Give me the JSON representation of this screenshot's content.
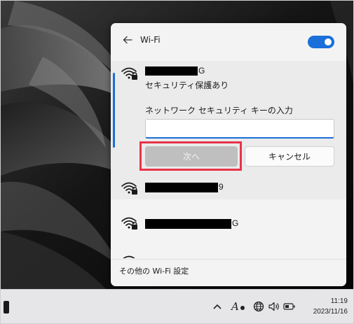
{
  "panel": {
    "title": "Wi-Fi",
    "toggle_on": true,
    "accent_color": "#1a6fd9"
  },
  "connecting_network": {
    "ssid_visible_suffix": "G",
    "security_status": "セキュリティ保護あり",
    "key_label": "ネットワーク セキュリティ キーの入力",
    "key_value": "",
    "next_button": "次へ",
    "cancel_button": "キャンセル",
    "highlight_color": "#e8334a"
  },
  "networks": [
    {
      "ssid_visible_suffix": "9",
      "icon": "wifi-secured-icon"
    },
    {
      "ssid_visible_suffix": "G",
      "icon": "wifi-secured-icon"
    }
  ],
  "footer": {
    "more_settings": "その他の Wi-Fi 設定"
  },
  "taskbar": {
    "time": "11:19",
    "date": "2023/11/16"
  }
}
